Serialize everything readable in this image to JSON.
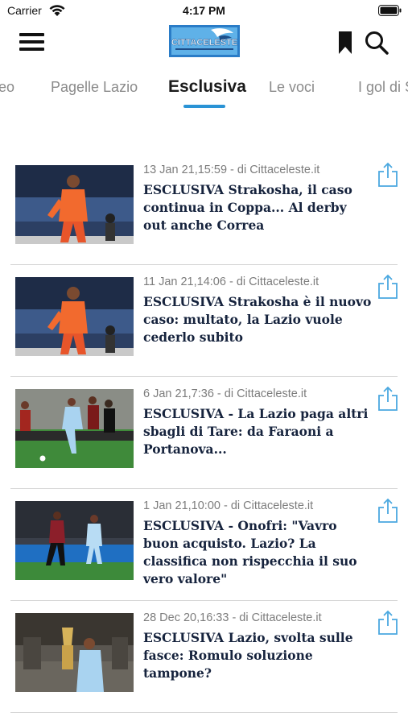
{
  "status_bar": {
    "carrier": "Carrier",
    "time": "4:17 PM"
  },
  "header": {
    "logo_text": "CITTACELESTE",
    "icons": {
      "menu": "menu-icon",
      "bookmark": "bookmark-icon",
      "search": "search-icon"
    }
  },
  "tabs": [
    {
      "label": "eo"
    },
    {
      "label": "Pagelle Lazio"
    },
    {
      "label": "Esclusiva",
      "active": true
    },
    {
      "label": "Le voci"
    },
    {
      "label": "I gol di S"
    }
  ],
  "colors": {
    "accent": "#2a93d5",
    "title": "#16233d",
    "meta": "#7c7c7c"
  },
  "articles": [
    {
      "meta": "13 Jan 21,15:59 - di Cittaceleste.it",
      "title": "ESCLUSIVA Strakosha, il caso continua in Coppa... Al derby out anche Correa"
    },
    {
      "meta": "11 Jan 21,14:06 - di Cittaceleste.it",
      "title": "ESCLUSIVA Strakosha è il nuovo caso: multato, la Lazio vuole cederlo subito"
    },
    {
      "meta": "6 Jan 21,7:36 - di Cittaceleste.it",
      "title": "ESCLUSIVA - La Lazio paga altri sbagli di Tare: da Faraoni a Portanova..."
    },
    {
      "meta": "1 Jan 21,10:00 - di Cittaceleste.it",
      "title": "ESCLUSIVA - Onofri: \"Vavro buon acquisto. Lazio? La classifica non rispecchia il suo vero valore\""
    },
    {
      "meta": "28 Dec 20,16:33 - di Cittaceleste.it",
      "title": "ESCLUSIVA Lazio, svolta sulle fasce: Romulo soluzione tampone?"
    }
  ]
}
